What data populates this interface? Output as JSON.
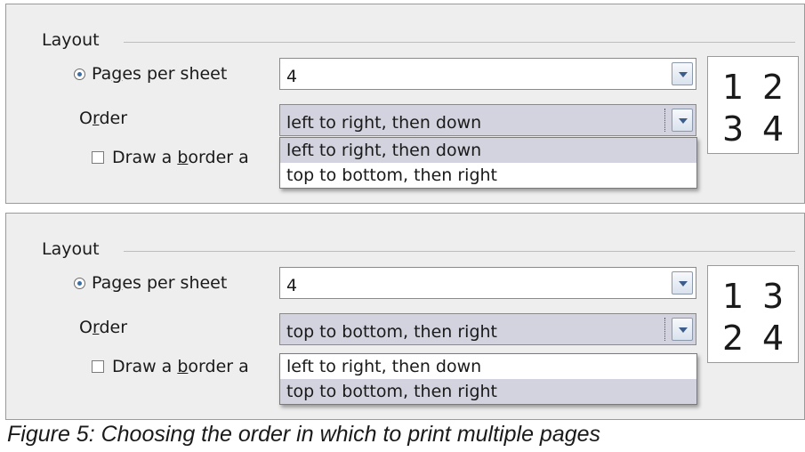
{
  "panels": [
    {
      "section_label": "Layout",
      "pages_per_sheet": {
        "label_before": "Pa",
        "label_accel": "g",
        "label_after": "es per sheet",
        "value": "4"
      },
      "order": {
        "label_before": "O",
        "label_accel": "r",
        "label_after": "der",
        "value": "left to right, then down"
      },
      "draw_border": {
        "label_before": "Draw a ",
        "label_accel": "b",
        "label_after": "order a",
        "checked": false
      },
      "dropdown_options": [
        "left to right, then down",
        "top to bottom, then right"
      ],
      "selected_option": "left to right, then down",
      "preview": [
        "1",
        "2",
        "3",
        "4"
      ]
    },
    {
      "section_label": "Layout",
      "pages_per_sheet": {
        "label_before": "Pa",
        "label_accel": "g",
        "label_after": "es per sheet",
        "value": "4"
      },
      "order": {
        "label_before": "O",
        "label_accel": "r",
        "label_after": "der",
        "value": "top to bottom, then right"
      },
      "draw_border": {
        "label_before": "Draw a ",
        "label_accel": "b",
        "label_after": "order a",
        "checked": false
      },
      "dropdown_options": [
        "left to right, then down",
        "top to bottom, then right"
      ],
      "selected_option": "top to bottom, then right",
      "preview": [
        "1",
        "3",
        "2",
        "4"
      ]
    }
  ],
  "caption": "Figure 5: Choosing the order in which to print multiple pages",
  "colors": {
    "panel_bg": "#eeeeee",
    "selection": "#d3d3df",
    "radio_dot": "#3a6ea5"
  }
}
